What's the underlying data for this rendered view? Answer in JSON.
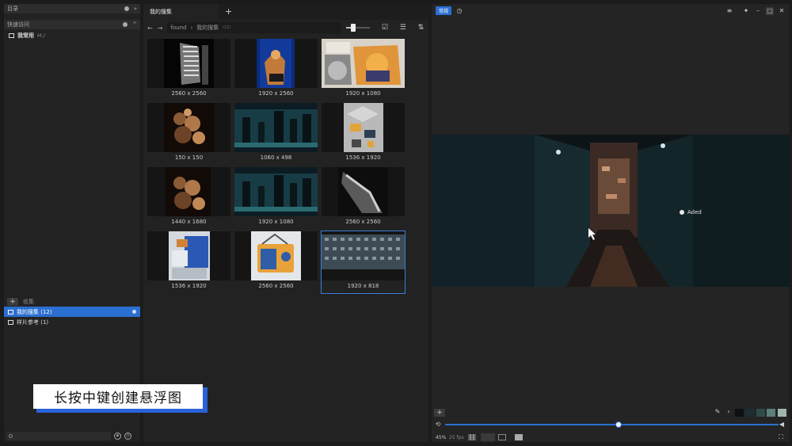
{
  "left_panel": {
    "directory_title": "目录",
    "quick_access_title": "快速访问",
    "quick_items": [
      {
        "label": "我常用",
        "sub": "H:/"
      }
    ],
    "collection_title": "收集",
    "collection_add": "+",
    "collections": [
      {
        "label": "我的搜集 (12)",
        "selected": true
      },
      {
        "label": "样片参考 (1)",
        "selected": false
      }
    ]
  },
  "overlay": {
    "hint": "长按中键创建悬浮图"
  },
  "middle_panel": {
    "tab_label": "我的搜集",
    "tab_add": "+",
    "breadcrumb": {
      "root": "found",
      "current": "我的搜集",
      "count": "(12)"
    },
    "zoom_slider": 0.2,
    "items": [
      {
        "dims": "2560 x 2560",
        "icon": "xray-skeleton"
      },
      {
        "dims": "1920 x 2560",
        "icon": "blue-poster"
      },
      {
        "dims": "1920 x 1080",
        "icon": "illustration-poster"
      },
      {
        "dims": "150 x 150",
        "icon": "crowd-render"
      },
      {
        "dims": "1060 x 498",
        "icon": "city-night"
      },
      {
        "dims": "1536 x 1920",
        "icon": "isometric-blocks"
      },
      {
        "dims": "1440 x 1680",
        "icon": "crowd-render"
      },
      {
        "dims": "1920 x 1080",
        "icon": "city-night"
      },
      {
        "dims": "2560 x 2560",
        "icon": "metal-render"
      },
      {
        "dims": "1536 x 1920",
        "icon": "blue-room"
      },
      {
        "dims": "2560 x 2560",
        "icon": "yellow-radio"
      },
      {
        "dims": "1920 x 818",
        "icon": "building-facade",
        "selected": true
      }
    ]
  },
  "right_panel": {
    "badge": "常规",
    "viewer_image": "dark-alley",
    "viewer_text": "Aded",
    "zoom": "45%",
    "fps": "25 fps",
    "playback_progress": 0.52,
    "palette": [
      "#0c1012",
      "#1e2d33",
      "#2f4a4b",
      "#5e7e79",
      "#9fb5b0",
      "#e6ecee"
    ],
    "colors": {
      "accent": "#2a6fd1"
    }
  }
}
